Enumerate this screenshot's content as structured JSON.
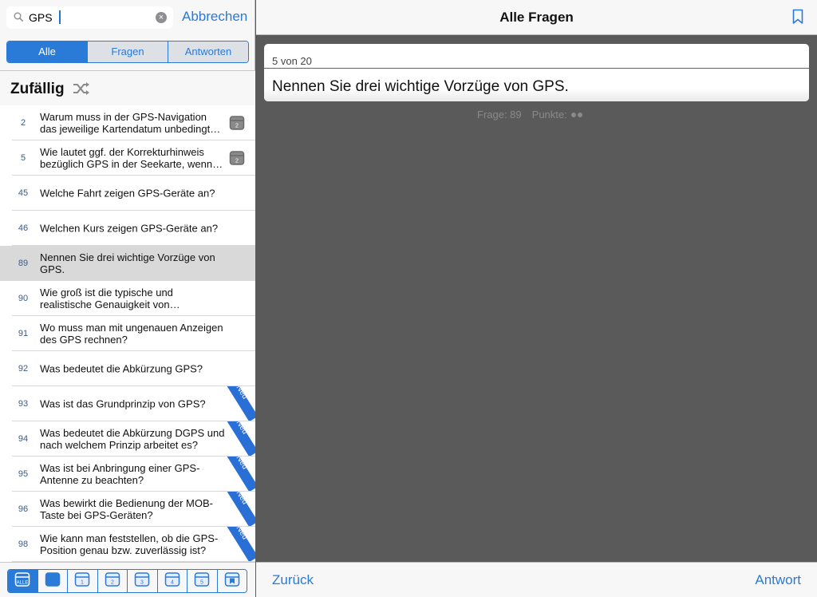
{
  "search": {
    "value": "GPS",
    "cancel_label": "Abbrechen"
  },
  "filter_tabs": [
    {
      "label": "Alle",
      "active": true
    },
    {
      "label": "Fragen",
      "active": false
    },
    {
      "label": "Antworten",
      "active": false
    }
  ],
  "list_header": {
    "title": "Zufällig",
    "icon": "shuffle-icon"
  },
  "questions": [
    {
      "num": "2",
      "text": "Warum muss in der GPS-Navigation das jeweilige Kartendatum unbedingt beachtet werden?",
      "box": "2",
      "new": false,
      "selected": false
    },
    {
      "num": "5",
      "text": "Wie lautet ggf. der Korrekturhinweis bezüglich GPS in der Seekarte, wenn das Kartendatum abweicht?",
      "box": "2",
      "new": false,
      "selected": false
    },
    {
      "num": "45",
      "text": "Welche Fahrt zeigen GPS-Geräte an?",
      "box": "",
      "new": false,
      "selected": false
    },
    {
      "num": "46",
      "text": "Welchen Kurs zeigen GPS-Geräte an?",
      "box": "",
      "new": false,
      "selected": false
    },
    {
      "num": "89",
      "text": "Nennen Sie drei wichtige Vorzüge von GPS.",
      "box": "",
      "new": false,
      "selected": true
    },
    {
      "num": "90",
      "text": "Wie groß ist die typische und realistische Genauigkeit von Positionsangaben?",
      "box": "",
      "new": false,
      "selected": false
    },
    {
      "num": "91",
      "text": "Wo muss man mit ungenauen Anzeigen des GPS rechnen?",
      "box": "",
      "new": false,
      "selected": false
    },
    {
      "num": "92",
      "text": "Was bedeutet die Abkürzung GPS?",
      "box": "",
      "new": false,
      "selected": false
    },
    {
      "num": "93",
      "text": "Was ist das Grundprinzip von GPS?",
      "box": "",
      "new": true,
      "selected": false
    },
    {
      "num": "94",
      "text": "Was bedeutet die Abkürzung DGPS und nach welchem Prinzip arbeitet es?",
      "box": "",
      "new": true,
      "selected": false
    },
    {
      "num": "95",
      "text": "Was ist bei Anbringung einer GPS-Antenne zu beachten?",
      "box": "",
      "new": true,
      "selected": false
    },
    {
      "num": "96",
      "text": "Was bewirkt die Bedienung der MOB-Taste bei GPS-Geräten?",
      "box": "",
      "new": true,
      "selected": false
    },
    {
      "num": "98",
      "text": "Wie kann man feststellen, ob die GPS-Position genau bzw. zuverlässig ist?",
      "box": "",
      "new": true,
      "selected": false
    }
  ],
  "new_label": "Neu",
  "box_filter": [
    {
      "label": "ALLE",
      "active": true
    },
    {
      "label": "",
      "active": false
    },
    {
      "label": "1",
      "active": false
    },
    {
      "label": "2",
      "active": false
    },
    {
      "label": "3",
      "active": false
    },
    {
      "label": "4",
      "active": false
    },
    {
      "label": "5",
      "active": false
    },
    {
      "label": "",
      "active": false,
      "icon": "bookmark-box-icon"
    }
  ],
  "detail": {
    "title": "Alle Fragen",
    "progress": "5 von 20",
    "question": "Nennen Sie drei wichtige Vorzüge von GPS.",
    "question_label": "Frage: 89",
    "points_label": "Punkte:",
    "points": 2,
    "back_label": "Zurück",
    "answer_label": "Antwort"
  },
  "colors": {
    "accent": "#2a7ad8",
    "background": "#5a5a5a",
    "ribbon": "#2a6fd6"
  }
}
